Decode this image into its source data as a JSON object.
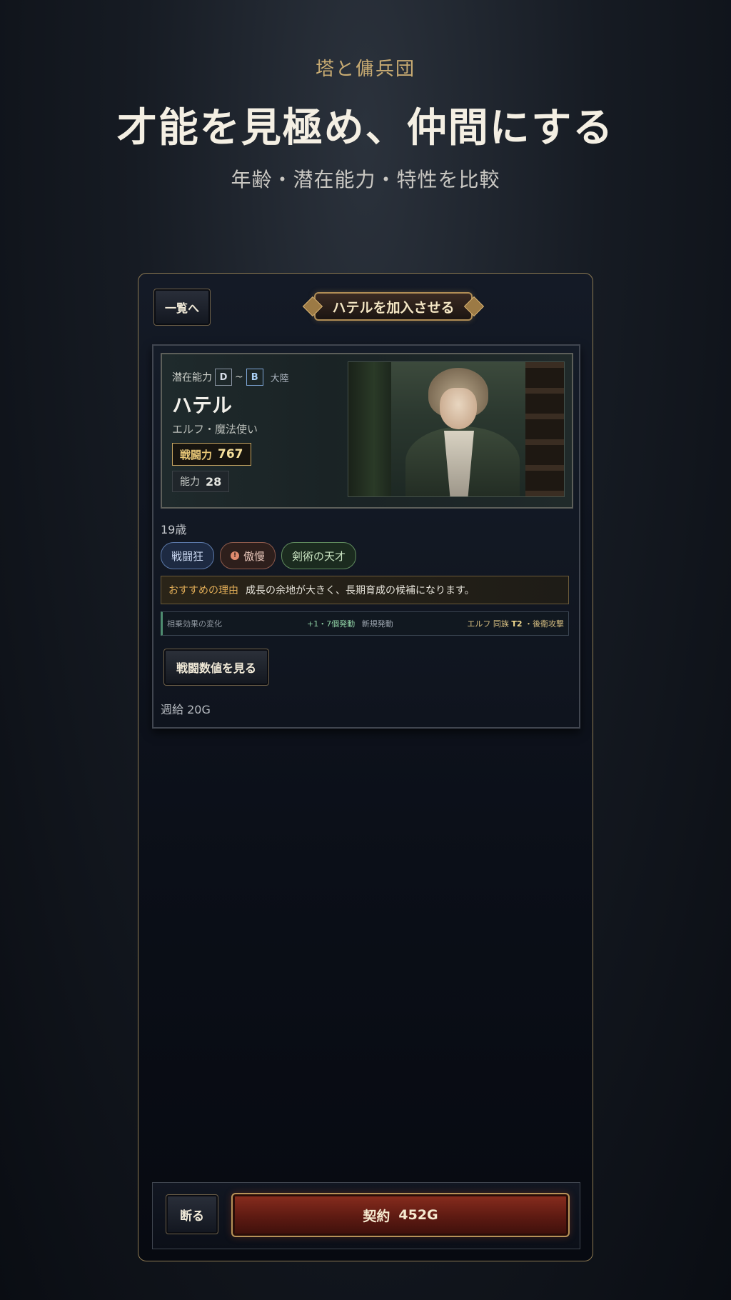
{
  "promo": {
    "kicker": "塔と傭兵団",
    "title": "才能を見極め、仲間にする",
    "subtitle": "年齢・潜在能力・特性を比較"
  },
  "topbar": {
    "back_label": "一覧へ",
    "title": "ハテルを加入させる"
  },
  "character": {
    "potential_label": "潜在能力",
    "potential_min": "D",
    "potential_sep": "~",
    "potential_max": "B",
    "continent": "大陸",
    "name": "ハテル",
    "class": "エルフ・魔法使い",
    "power_label": "戦闘力",
    "power_value": "767",
    "ability_label": "能力",
    "ability_value": "28",
    "age": "19歳"
  },
  "traits": [
    {
      "label": "戦闘狂",
      "style": "blue"
    },
    {
      "label": "傲慢",
      "style": "red",
      "icon": "warning-icon"
    },
    {
      "label": "剣術の天才",
      "style": "green"
    }
  ],
  "recommend": {
    "label": "おすすめの理由",
    "text": "成長の余地が大きく、長期育成の候補になります。"
  },
  "synergy": {
    "label": "相乗効果の変化",
    "change": "+1・7個発動",
    "status": "新規発動",
    "detail_prefix": "エルフ 同族",
    "detail_tier": "T2",
    "detail_suffix": "・後衛攻撃"
  },
  "stats_button": "戦闘数値を見る",
  "salary": "週給 20G",
  "actions": {
    "decline": "断る",
    "contract_label": "契約",
    "contract_price": "452G"
  },
  "colors": {
    "accent_gold": "#c8ab72",
    "contract_red": "#8a2d1e",
    "background": "#0a0d13"
  }
}
